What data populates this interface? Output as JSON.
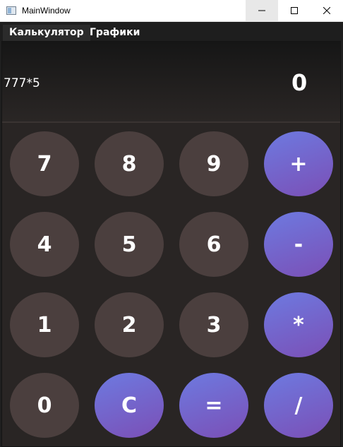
{
  "window": {
    "title": "MainWindow"
  },
  "menu": {
    "tabs": [
      {
        "label": "Калькулятор"
      },
      {
        "label": "Графики"
      }
    ]
  },
  "display": {
    "expression": "777*5",
    "result": "0"
  },
  "keys": {
    "row1": [
      "7",
      "8",
      "9",
      "+"
    ],
    "row2": [
      "4",
      "5",
      "6",
      "-"
    ],
    "row3": [
      "1",
      "2",
      "3",
      "*"
    ],
    "row4": [
      "0",
      "C",
      "=",
      "/"
    ]
  },
  "colors": {
    "number_key": "#4b3f3e",
    "operator_key_gradient": [
      "#6d7ae0",
      "#7b4fb6"
    ],
    "background": "#292524"
  }
}
